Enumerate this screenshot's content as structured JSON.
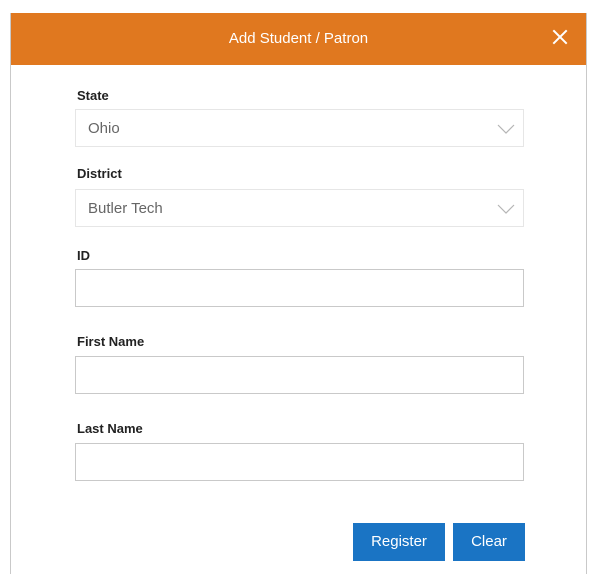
{
  "dialog": {
    "title": "Add Student / Patron",
    "close_icon": "close-icon"
  },
  "form": {
    "state": {
      "label": "State",
      "value": "Ohio"
    },
    "district": {
      "label": "District",
      "value": "Butler Tech"
    },
    "id": {
      "label": "ID",
      "value": ""
    },
    "first_name": {
      "label": "First Name",
      "value": ""
    },
    "last_name": {
      "label": "Last Name",
      "value": ""
    }
  },
  "actions": {
    "register_label": "Register",
    "clear_label": "Clear"
  },
  "colors": {
    "header": "#e0781f",
    "button": "#1a74c4"
  }
}
